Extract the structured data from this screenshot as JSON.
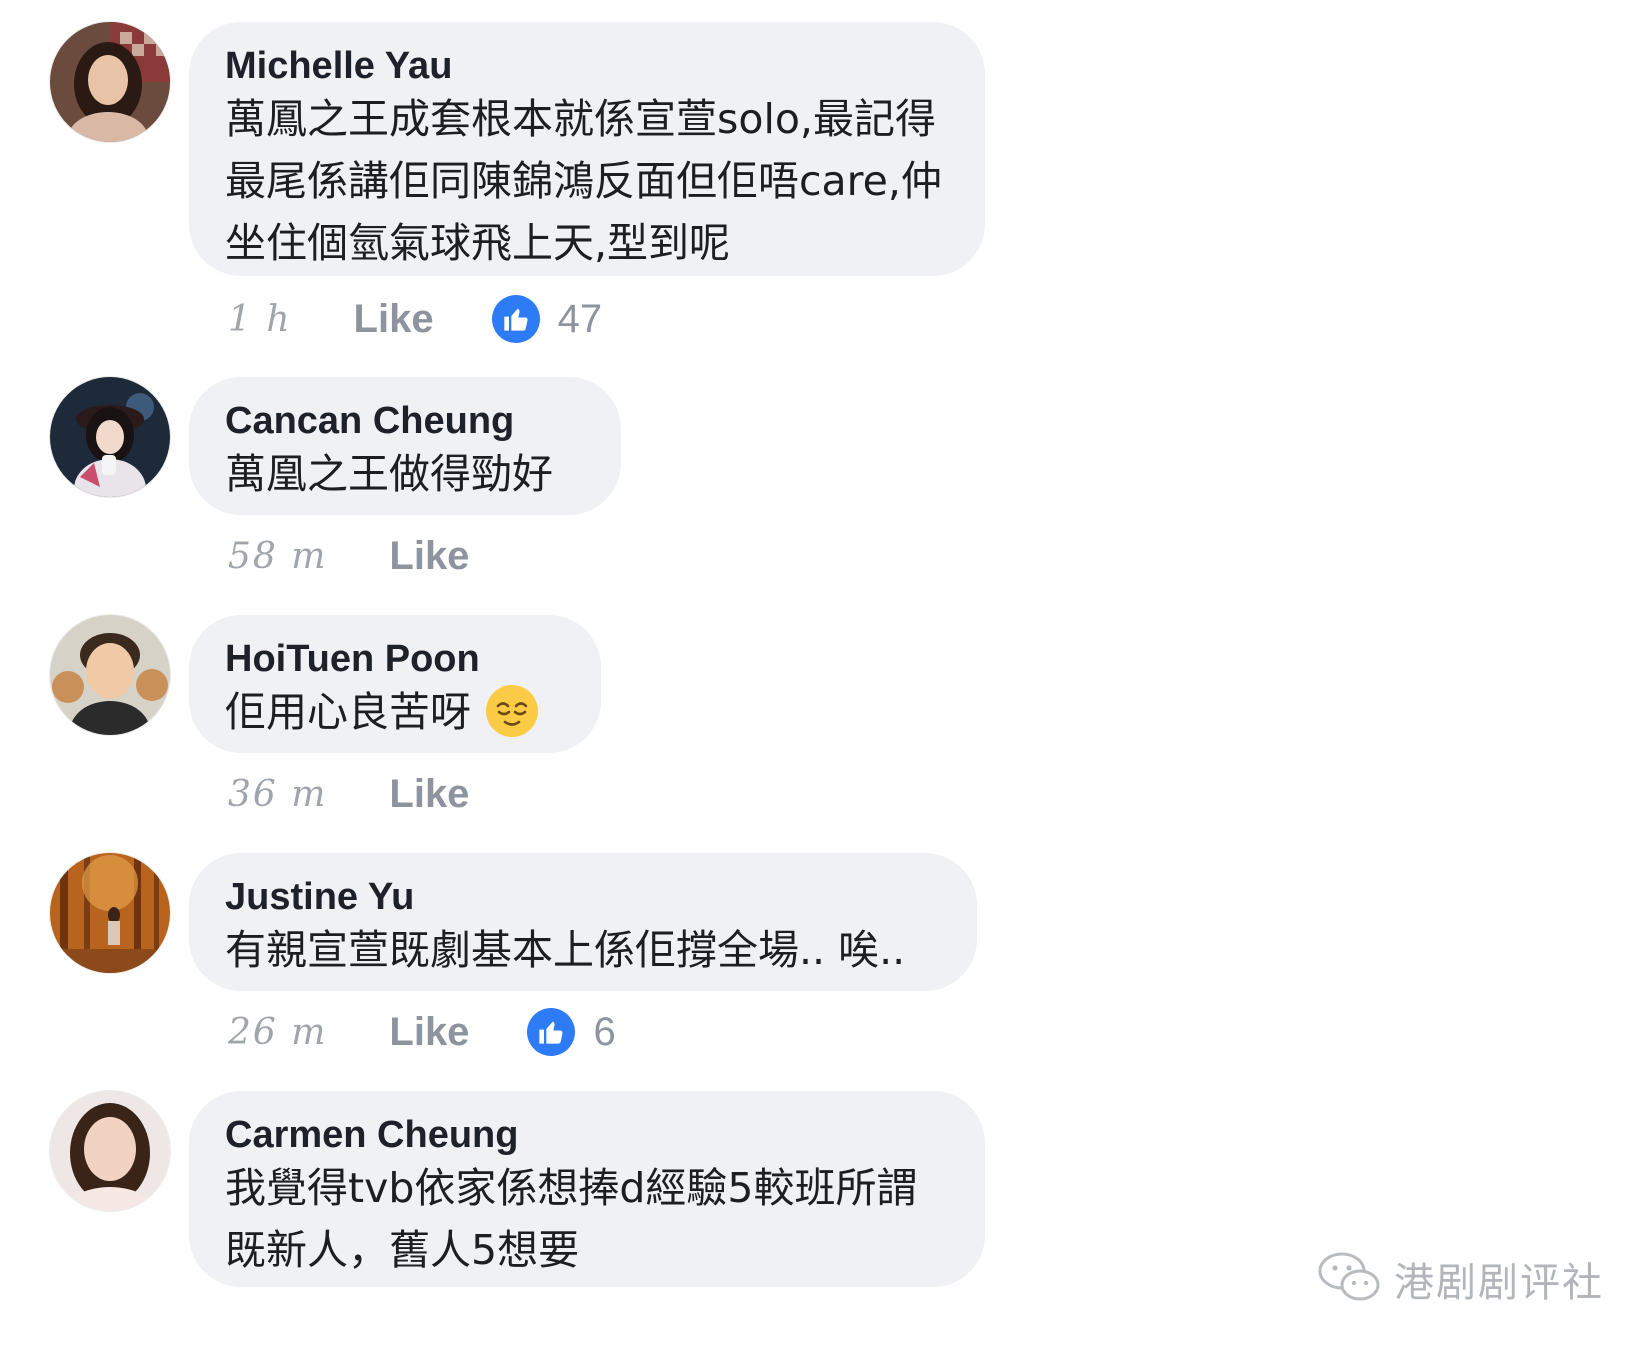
{
  "comments": [
    {
      "author": "Michelle Yau",
      "text": "萬鳳之王成套根本就係宣萱solo,最記得最尾係講佢同陳錦鴻反面但佢唔care,仲坐住個氫氣球飛上天,型到呢",
      "time": "1 h",
      "like_label": "Like",
      "reaction_count": "47"
    },
    {
      "author": "Cancan Cheung",
      "text": "萬凰之王做得勁好",
      "time": "58 m",
      "like_label": "Like"
    },
    {
      "author": "HoiTuen Poon",
      "text": "佢用心良苦呀",
      "emoji": "relieved-face",
      "time": "36 m",
      "like_label": "Like"
    },
    {
      "author": "Justine Yu",
      "text": "有親宣萱既劇基本上係佢撐全場.. 唉..",
      "time": "26 m",
      "like_label": "Like",
      "reaction_count": "6"
    },
    {
      "author": "Carmen Cheung",
      "text": "我覺得tvb依家係想捧d經驗5較班所謂既新人，舊人5想要"
    }
  ],
  "watermark": {
    "icon": "wechat-icon",
    "text": "港剧剧评社"
  },
  "colors": {
    "bubble": "#f0f1f4",
    "like_blue": "#2d7cf6",
    "meta_gray": "#8d949e"
  }
}
